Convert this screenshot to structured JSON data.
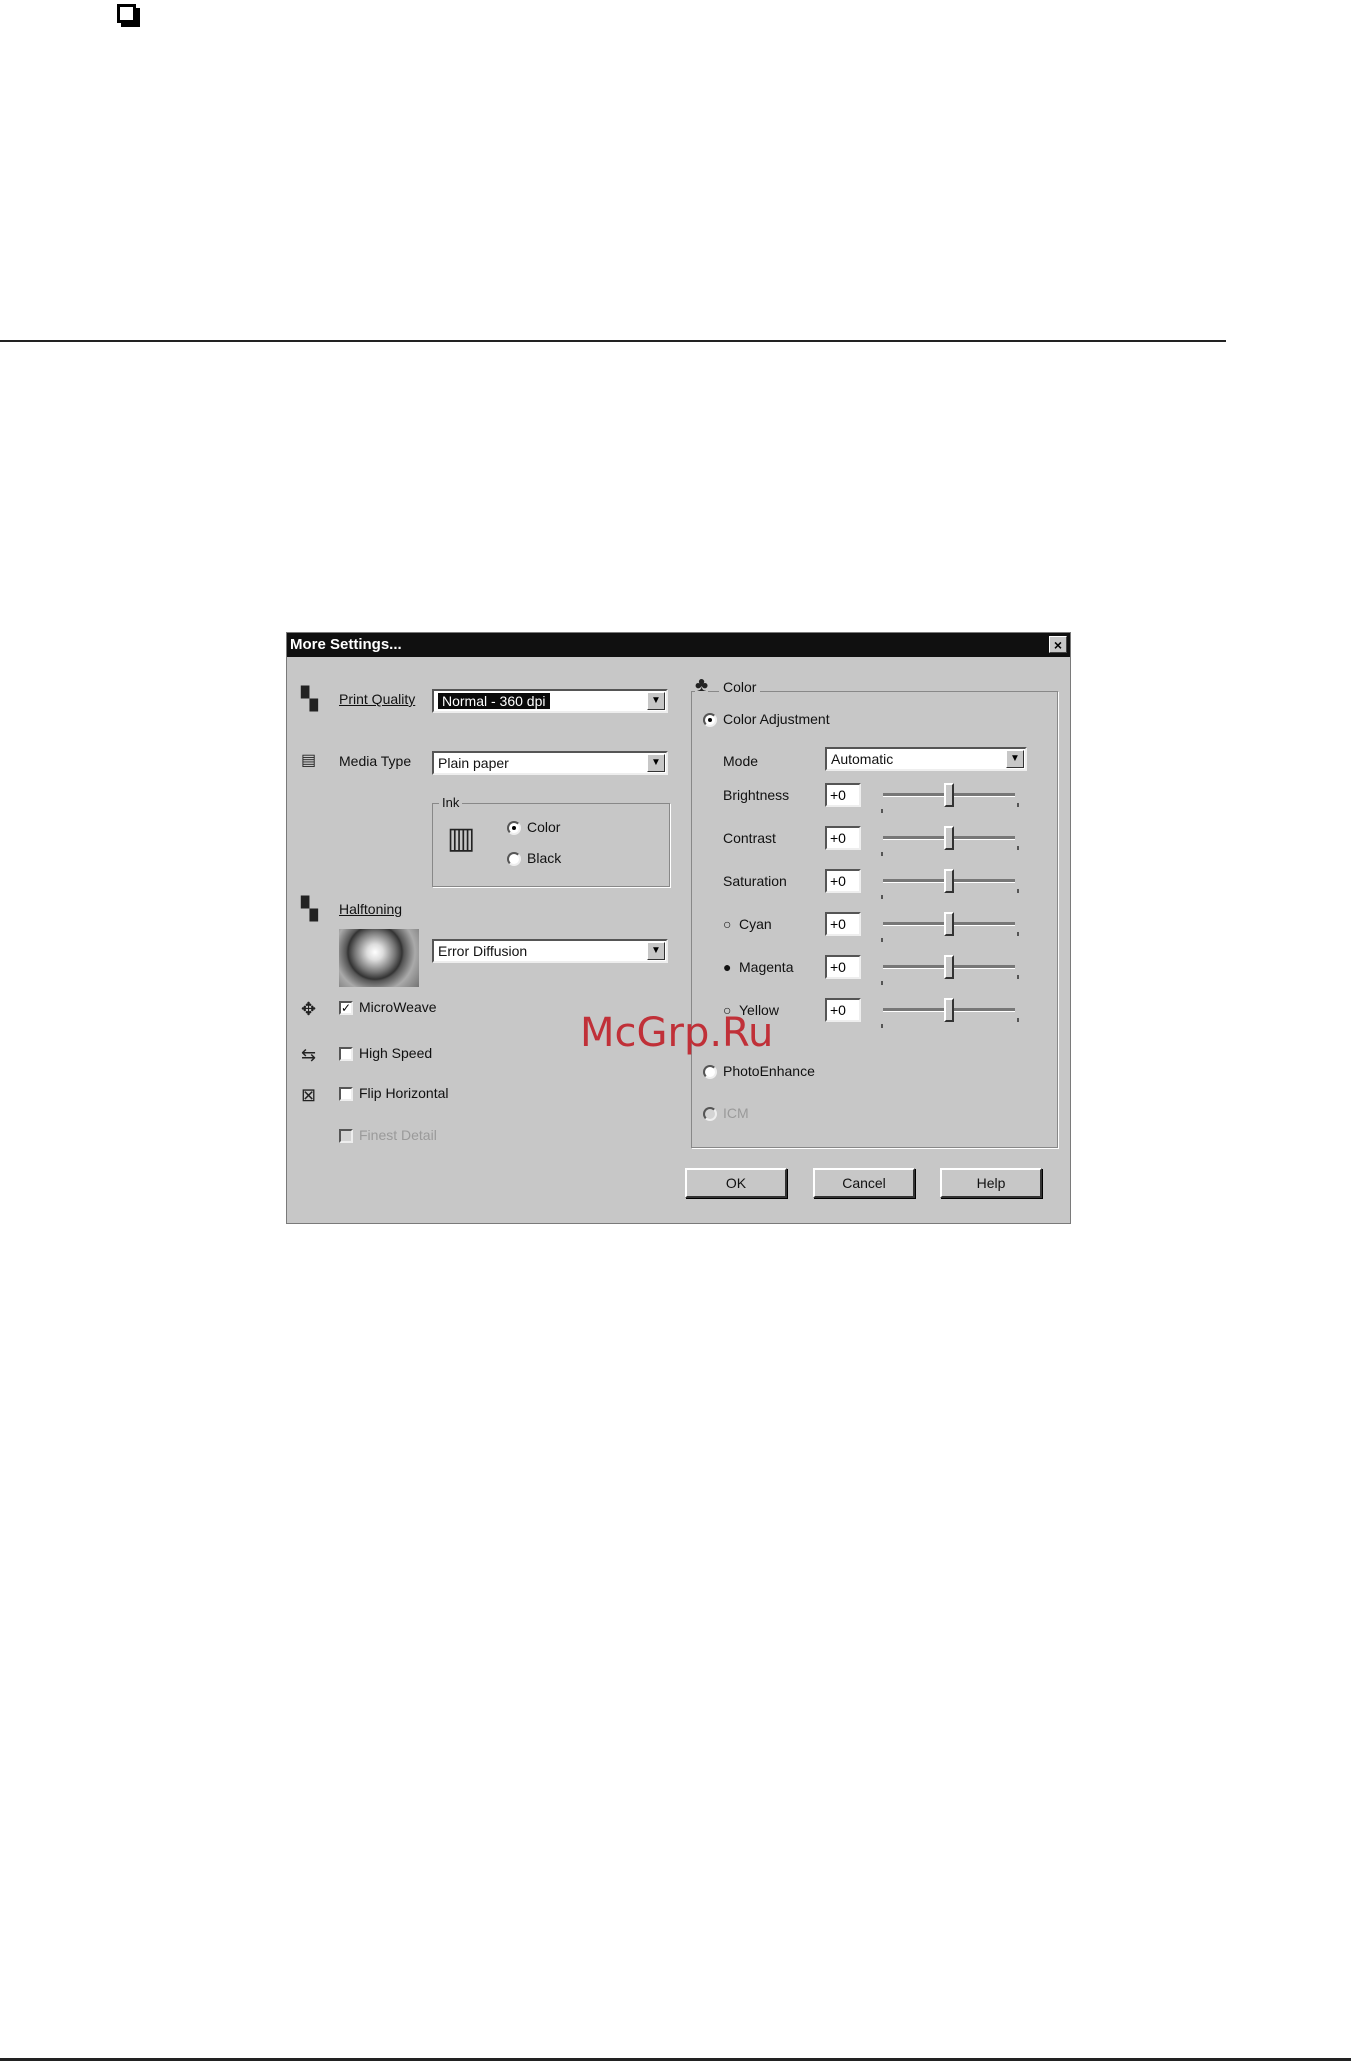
{
  "page": {
    "watermark": "McGrp.Ru"
  },
  "dialog": {
    "title": "More Settings...",
    "close_glyph": "×",
    "print_quality": {
      "label": "Print Quality",
      "value": "Normal - 360 dpi",
      "icon": "print-quality-icon"
    },
    "media_type": {
      "label": "Media Type",
      "value": "Plain paper",
      "icon": "media-type-icon"
    },
    "ink": {
      "label": "Ink",
      "icon": "ink-cartridge-icon",
      "options": [
        {
          "label": "Color",
          "selected": true
        },
        {
          "label": "Black",
          "selected": false
        }
      ]
    },
    "halftoning": {
      "label": "Halftoning",
      "value": "Error Diffusion",
      "icon": "halftoning-icon"
    },
    "microweave": {
      "label": "MicroWeave",
      "checked": true,
      "icon": "microweave-icon"
    },
    "high_speed": {
      "label": "High Speed",
      "checked": false,
      "icon": "high-speed-icon"
    },
    "flip_horizontal": {
      "label": "Flip Horizontal",
      "checked": false,
      "icon": "flip-horizontal-icon"
    },
    "finest_detail": {
      "label": "Finest Detail",
      "checked": false,
      "enabled": false
    },
    "color": {
      "group_label": "Color",
      "icon": "color-palette-icon",
      "color_adjustment": {
        "label": "Color Adjustment",
        "selected": true
      },
      "mode": {
        "label": "Mode",
        "value": "Automatic"
      },
      "sliders": [
        {
          "label": "Brightness",
          "value": "+0",
          "level": 0.5,
          "prefix": ""
        },
        {
          "label": "Contrast",
          "value": "+0",
          "level": 0.5,
          "prefix": ""
        },
        {
          "label": "Saturation",
          "value": "+0",
          "level": 0.5,
          "prefix": ""
        },
        {
          "label": "Cyan",
          "value": "+0",
          "level": 0.5,
          "prefix": "○"
        },
        {
          "label": "Magenta",
          "value": "+0",
          "level": 0.5,
          "prefix": "●"
        },
        {
          "label": "Yellow",
          "value": "+0",
          "level": 0.5,
          "prefix": "○"
        }
      ],
      "photoenhance": {
        "label": "PhotoEnhance",
        "selected": false
      },
      "icm": {
        "label": "ICM",
        "selected": false,
        "enabled": false
      }
    },
    "buttons": {
      "ok": "OK",
      "cancel": "Cancel",
      "help": "Help"
    }
  }
}
